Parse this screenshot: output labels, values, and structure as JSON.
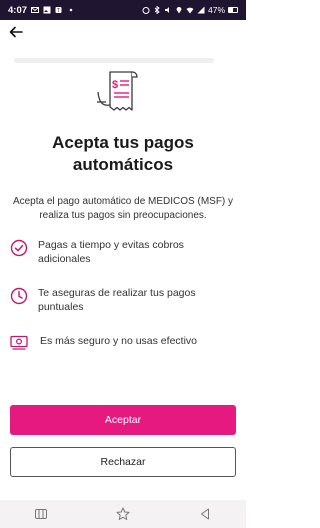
{
  "status_bar": {
    "time": "4:07",
    "battery": "47%"
  },
  "screen": {
    "title": "Acepta tus pagos automáticos",
    "subtitle": "Acepta el pago automático de MEDICOS (MSF) y realiza tus pagos sin preocupaciones.",
    "benefits": [
      {
        "icon": "check-circle-icon",
        "text": "Pagas a tiempo y evitas cobros adicionales"
      },
      {
        "icon": "clock-icon",
        "text": "Te aseguras de realizar tus pagos puntuales"
      },
      {
        "icon": "cash-icon",
        "text": "Es más seguro y no usas efectivo"
      }
    ]
  },
  "actions": {
    "accept_label": "Aceptar",
    "reject_label": "Rechazar"
  },
  "colors": {
    "accent": "#e5197f",
    "status_bar": "#1f1530"
  }
}
